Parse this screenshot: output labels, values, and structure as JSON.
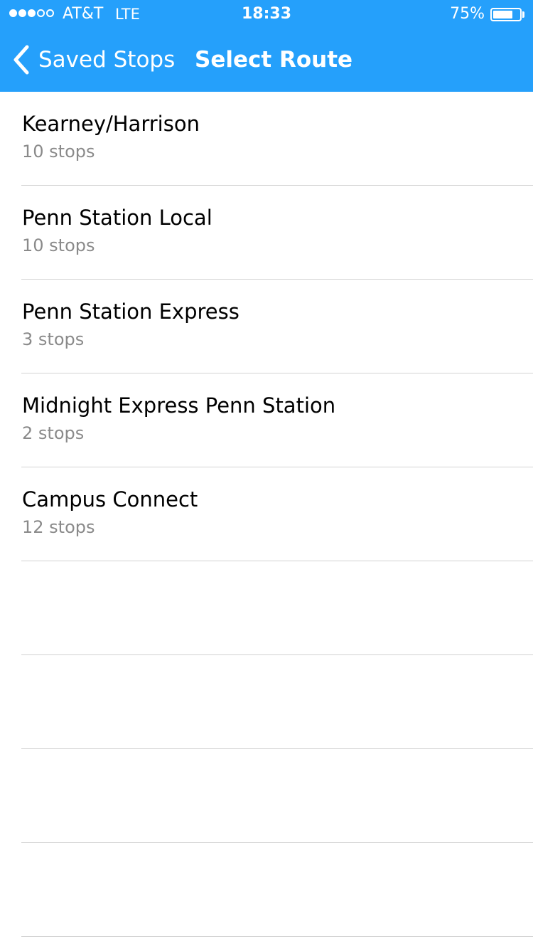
{
  "status_bar": {
    "carrier": "AT&T",
    "network": "LTE",
    "time": "18:33",
    "battery_percent": "75%",
    "battery_level": 0.75,
    "signal_bars_filled": 3,
    "signal_bars_total": 5
  },
  "nav": {
    "back_label": "Saved Stops",
    "title": "Select Route",
    "accent_color": "#25a0fb"
  },
  "routes": [
    {
      "name": "Kearney/Harrison",
      "stops": "10 stops"
    },
    {
      "name": "Penn Station Local",
      "stops": "10 stops"
    },
    {
      "name": "Penn Station Express",
      "stops": "3 stops"
    },
    {
      "name": "Midnight Express Penn Station",
      "stops": "2 stops"
    },
    {
      "name": "Campus Connect",
      "stops": "12 stops"
    }
  ],
  "empty_rows": 4,
  "icons": {
    "back": "chevron-left-icon",
    "battery": "battery-icon",
    "signal": "signal-strength-icon"
  }
}
